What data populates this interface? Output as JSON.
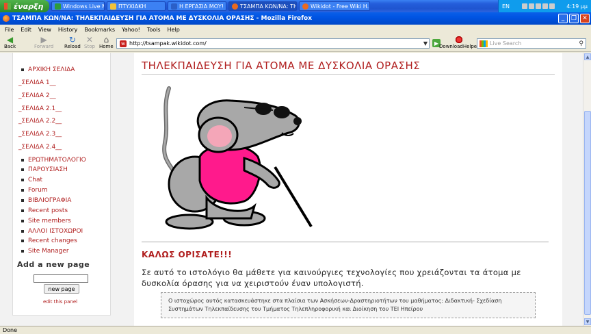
{
  "taskbar": {
    "start_label": "έναρξη",
    "tasks": [
      {
        "label": "Windows Live Messen..."
      },
      {
        "label": "ΠΤΥΧΙΑΚΗ"
      },
      {
        "label": "Η ΕΡΓΑΣΙΑ ΜΟΥ! - Mi..."
      },
      {
        "label": "ΤΣΑΜΠΑ ΚΩΝ/ΝΑ: ΤΗ..."
      },
      {
        "label": "Wikidot - Free Wiki H..."
      }
    ],
    "tray": {
      "lang": "EN",
      "time": "4:19 μμ"
    }
  },
  "window": {
    "title": "ΤΣΑΜΠΑ ΚΩΝ/ΝΑ: ΤΗΛΕΚΠΑΙΔΕΥΣΗ ΓΙΑ ΑΤΟΜΑ ΜΕ ΔΥΣΚΟΛΙΑ ΟΡΑΣΗΣ - Mozilla Firefox"
  },
  "menu": [
    "File",
    "Edit",
    "View",
    "History",
    "Bookmarks",
    "Yahoo!",
    "Tools",
    "Help"
  ],
  "toolbar": {
    "back": "Back",
    "forward": "Forward",
    "reload": "Reload",
    "stop": "Stop",
    "home": "Home",
    "url": "http://tsampak.wikidot.com/",
    "download_helper": "DownloadHelper",
    "search_placeholder": "Live Search"
  },
  "sidebar": {
    "home_link": "ΑΡΧΙΚΗ ΣΕΛΙΔΑ",
    "pages": [
      "_ΣΕΛΙΔΑ 1__",
      "_ΣΕΛΙΔΑ 2__",
      "_ΣΕΛΙΔΑ 2.1__",
      "_ΣΕΛΙΔΑ 2.2__",
      "_ΣΕΛΙΔΑ 2.3__",
      "_ΣΕΛΙΔΑ 2.4__"
    ],
    "links": [
      "ΕΡΩΤΗΜΑΤΟΛΟΓΙΟ",
      "ΠΑΡΟΥΣΙΑΣΗ",
      "Chat",
      "Forum",
      "ΒΙΒΛΙΟΓΡΑΦΙΑ",
      "Recent posts",
      "Site members",
      "ΑΛΛΟΙ ΙΣΤΟΧΩΡΟΙ",
      "Recent changes",
      "Site Manager"
    ],
    "add_page_heading": "Add a new page",
    "new_page_button": "new page",
    "edit_panel": "edit this panel"
  },
  "content": {
    "title": "ΤΗΛΕΚΠΑΙΔΕΥΣΗ ΓΙΑ ΑΤΟΜΑ ΜΕ ΔΥΣΚΟΛΙΑ ΟΡΑΣΗΣ",
    "welcome": "ΚΑΛΩΣ ΟΡΙΣΑΤΕ!!!",
    "intro": "Σε αυτό το ιστολόγιο θα μάθετε για καινούργιες τεχνολογίες που χρειάζονται τα άτομα με δυσκολία όρασης για να χειριστούν έναν υπολογιστή.",
    "note": "Ο ιστοχώρος αυτός κατασκευάστηκε στα πλαίσια των Ασκήσεων-Δραστηριοτήτων του μαθήματος: Διδακτική- Σχεδίαση Συστημάτων Τηλεκπαίδευσης του Τμήματος Τηλεπληροφορική και Διοίκηση του ΤΕΙ Ηπείρου"
  },
  "status": "Done",
  "colors": {
    "link": "#b01e1e",
    "accent_pink": "#ff1a8c",
    "mouse_gray": "#a8a8a8"
  }
}
